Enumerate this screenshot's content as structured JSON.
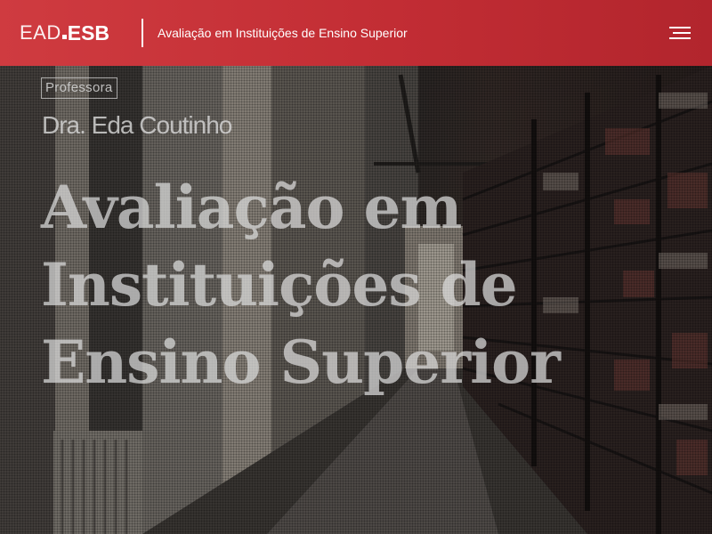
{
  "header": {
    "logo": {
      "ead": "EAD",
      "esb": "ESB"
    },
    "title": "Avaliação em Instituições de Ensino Superior",
    "menu_icon": "hamburger-menu-icon",
    "background_color": "#c8323a"
  },
  "hero": {
    "badge": "Professora",
    "author": "Dra. Eda Coutinho",
    "title_lines": [
      "Avaliação em",
      "Instituições de",
      "Ensino Superior"
    ],
    "background_image": "library-bookshelves-photo"
  }
}
